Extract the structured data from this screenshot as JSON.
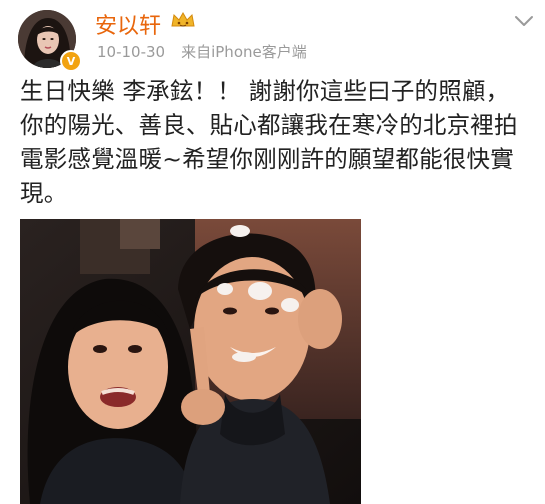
{
  "user": {
    "name": "安以轩",
    "verified_mark": "V",
    "avatar_icon": "avatar-icon",
    "member_icon": "vip-crown-icon"
  },
  "meta": {
    "date": "10-10-30",
    "source": "来自iPhone客户端"
  },
  "post": {
    "text": "生日快樂 李承鉉！！ 謝謝你這些曰子的照顧，你的陽光、善良、貼心都讓我在寒冷的北京裡拍電影感覺溫暖~希望你刚刚許的願望都能很快實現。"
  },
  "photo": {
    "subject": "photo-two-people"
  },
  "colors": {
    "username": "#e8660c",
    "meta": "#9a9a9a",
    "text": "#222222",
    "badge": "#f2a311"
  }
}
